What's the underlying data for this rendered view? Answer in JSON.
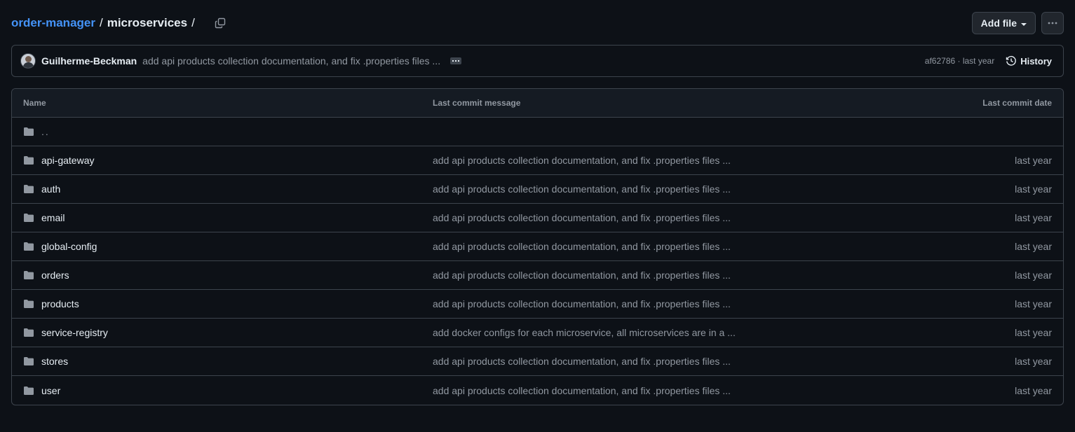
{
  "breadcrumb": {
    "repo": "order-manager",
    "sep1": "/",
    "dir": "microservices",
    "sep2": "/"
  },
  "actions": {
    "add_file": "Add file"
  },
  "commit": {
    "author": "Guilherme-Beckman",
    "message": "add api products collection documentation, and fix .properties files ...",
    "sha_date": "af62786 · last year",
    "history": "History"
  },
  "table": {
    "headers": {
      "name": "Name",
      "message": "Last commit message",
      "date": "Last commit date"
    },
    "parent": "..",
    "rows": [
      {
        "name": "api-gateway",
        "message": "add api products collection documentation, and fix .properties files ...",
        "date": "last year"
      },
      {
        "name": "auth",
        "message": "add api products collection documentation, and fix .properties files ...",
        "date": "last year"
      },
      {
        "name": "email",
        "message": "add api products collection documentation, and fix .properties files ...",
        "date": "last year"
      },
      {
        "name": "global-config",
        "message": "add api products collection documentation, and fix .properties files ...",
        "date": "last year"
      },
      {
        "name": "orders",
        "message": "add api products collection documentation, and fix .properties files ...",
        "date": "last year"
      },
      {
        "name": "products",
        "message": "add api products collection documentation, and fix .properties files ...",
        "date": "last year"
      },
      {
        "name": "service-registry",
        "message": "add docker configs for each microservice, all microservices are in a ...",
        "date": "last year"
      },
      {
        "name": "stores",
        "message": "add api products collection documentation, and fix .properties files ...",
        "date": "last year"
      },
      {
        "name": "user",
        "message": "add api products collection documentation, and fix .properties files ...",
        "date": "last year"
      }
    ]
  },
  "colors": {
    "background": "#0d1117",
    "link": "#4493f8",
    "border": "#3d444d",
    "muted": "#9198a1",
    "folder": "#9198a1"
  },
  "icons": {
    "copy": "copy-icon",
    "more": "kebab-horizontal-icon",
    "history": "history-icon",
    "folder": "folder-icon"
  }
}
